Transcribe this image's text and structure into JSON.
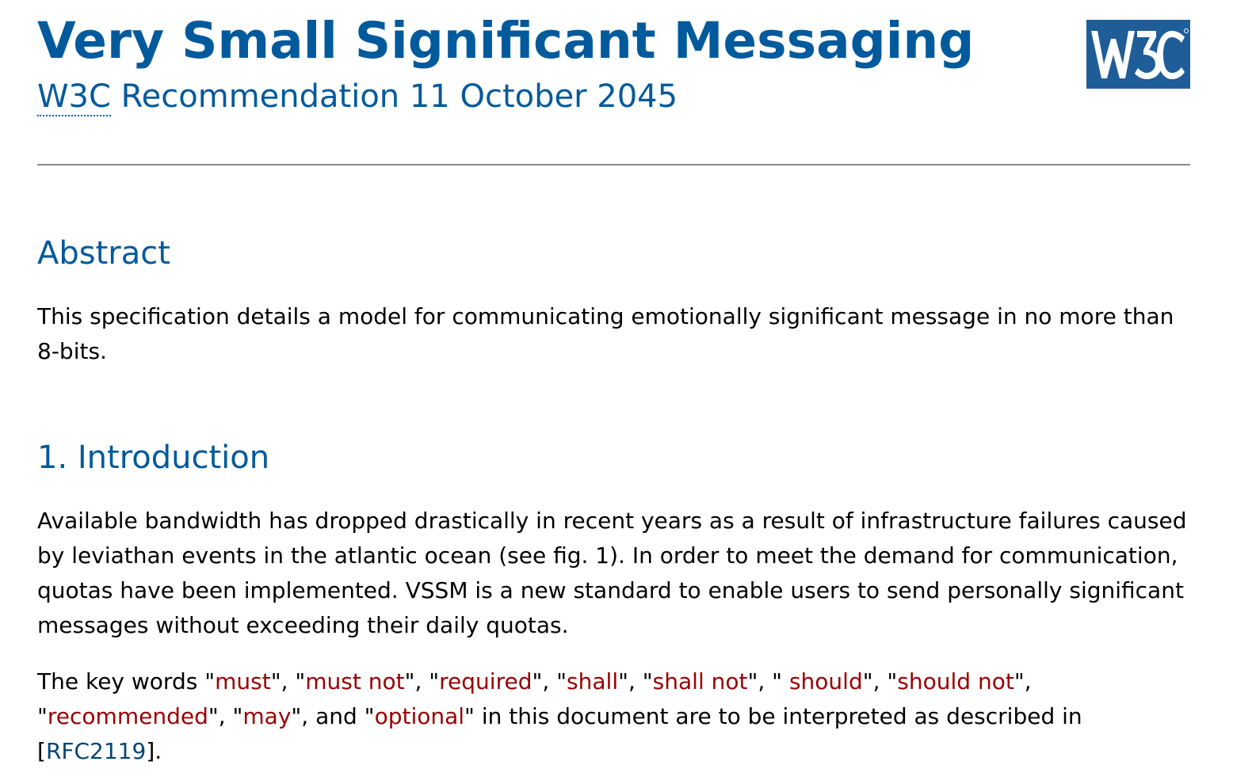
{
  "header": {
    "title": "Very Small Significant Messaging",
    "org_abbr": "W3C",
    "status_rest": " Recommendation 11 October 2045",
    "logo_text": "W3C"
  },
  "abstract": {
    "heading": "Abstract",
    "text": "This specification details a model for communicating emotionally significant message in no more than 8-bits."
  },
  "introduction": {
    "heading": "1. Introduction",
    "p1": "Available bandwidth has dropped drastically in recent years as a result of infrastructure failures caused by leviathan events in the atlantic ocean (see fig. 1). In order to meet the demand for communication, quotas have been implemented. VSSM is a new standard to enable users to send personally significant messages without exceeding their daily quotas.",
    "p2": {
      "prefix": "The key words \"",
      "keywords": [
        "must",
        "must not",
        "required",
        "shall",
        "shall not",
        "should",
        "should not",
        "recommended",
        "may",
        "optional"
      ],
      "sep": "\", \"",
      "sep_space": "\", \" ",
      "sep_and": "\", and \"",
      "suffix": "\" in this document are to be interpreted as described in [",
      "ref": "RFC2119",
      "end": "]."
    }
  },
  "colors": {
    "heading": "#005a9c",
    "keyword": "#990000",
    "link": "#034575",
    "logo_bg": "#1f5d99"
  }
}
